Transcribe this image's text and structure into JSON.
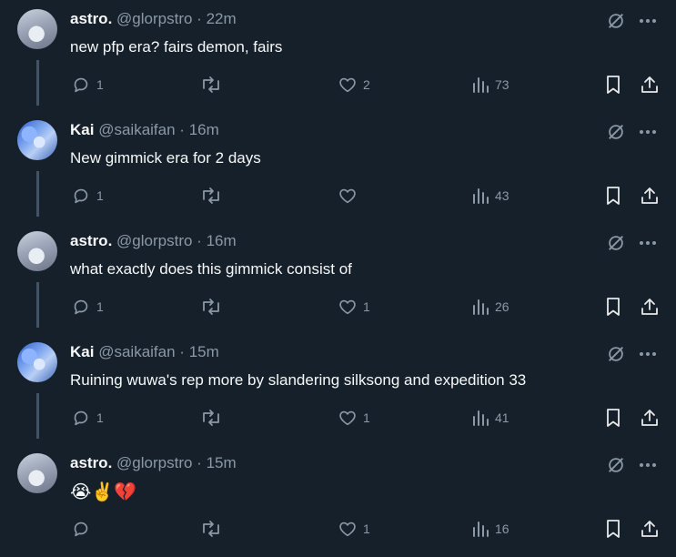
{
  "tweets": [
    {
      "name": "astro.",
      "handle": "@glorpstro",
      "separator": "·",
      "time": "22m",
      "text": "new pfp era? fairs demon, fairs",
      "avatar": "astro-avatar",
      "replies": "1",
      "retweets": "",
      "likes": "2",
      "views": "73"
    },
    {
      "name": "Kai",
      "handle": "@saikaifan",
      "separator": "·",
      "time": "16m",
      "text": "New gimmick era for 2 days",
      "avatar": "kai-avatar",
      "replies": "1",
      "retweets": "",
      "likes": "",
      "views": "43"
    },
    {
      "name": "astro.",
      "handle": "@glorpstro",
      "separator": "·",
      "time": "16m",
      "text": "what exactly does this gimmick consist of",
      "avatar": "astro-avatar",
      "replies": "1",
      "retweets": "",
      "likes": "1",
      "views": "26"
    },
    {
      "name": "Kai",
      "handle": "@saikaifan",
      "separator": "·",
      "time": "15m",
      "text": "Ruining wuwa's rep more by slandering silksong and expedition 33",
      "avatar": "kai-avatar",
      "replies": "1",
      "retweets": "",
      "likes": "1",
      "views": "41"
    },
    {
      "name": "astro.",
      "handle": "@glorpstro",
      "separator": "·",
      "time": "15m",
      "text": "😭✌️💔",
      "avatar": "astro-avatar",
      "replies": "",
      "retweets": "",
      "likes": "1",
      "views": "16"
    }
  ],
  "icons": {
    "reply": "reply-icon",
    "retweet": "retweet-icon",
    "like": "heart-icon",
    "views": "views-icon",
    "bookmark": "bookmark-icon",
    "share": "share-icon",
    "grok": "grok-icon",
    "more": "more-icon"
  },
  "colors": {
    "background": "#15202b",
    "text": "#f7f9f9",
    "muted": "#8b98a5",
    "thread_line": "#425364"
  }
}
